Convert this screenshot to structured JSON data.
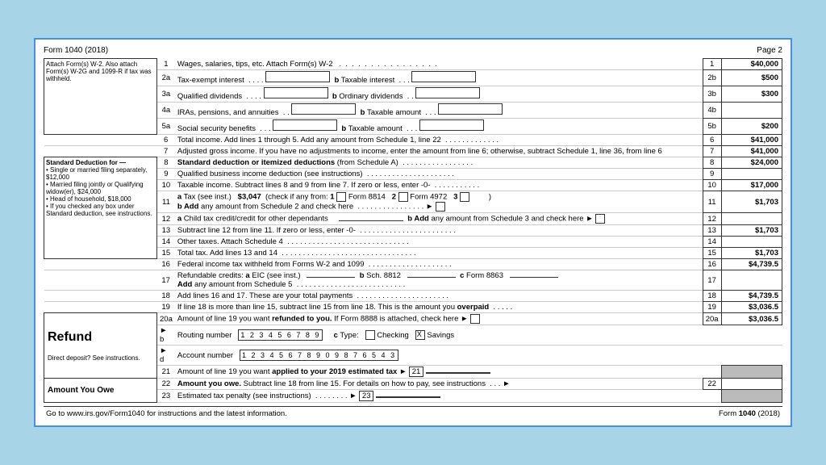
{
  "header": {
    "form_title": "Form 1040 (2018)",
    "page": "Page 2"
  },
  "sidebar_attach": "Attach Form(s) W-2. Also attach Form(s) W-2G and 1099-R if tax was withheld.",
  "sidebar_standard": {
    "title": "Standard Deduction for —",
    "items": [
      "• Single or married filing separately, $12,000",
      "• Married filing jointly or Qualifying widow(er), $24,000",
      "• Head of household, $18,000",
      "• If you checked any box under Standard deduction, see instructions."
    ]
  },
  "lines": {
    "l1": {
      "num": "1",
      "desc": "Wages, salaries, tips, etc. Attach Form(s) W-2",
      "amount": "$40,000"
    },
    "l2a": {
      "num": "2a",
      "desc": "Tax-exempt interest",
      "sub_num": "2a",
      "sub_label": "b Taxable interest",
      "sub_num2": "2b",
      "amount": "$500"
    },
    "l3a": {
      "num": "3a",
      "desc": "Qualified dividends",
      "sub_num": "3a",
      "sub_label": "b Ordinary dividends",
      "sub_num2": "3b",
      "amount": "$300"
    },
    "l4a": {
      "num": "4a",
      "desc": "IRAs, pensions, and annuities",
      "sub_num": "4a",
      "sub_label": "b Taxable amount",
      "sub_num2": "4b"
    },
    "l5a": {
      "num": "5a",
      "desc": "Social security benefits",
      "sub_num": "5a",
      "sub_label": "b Taxable amount",
      "sub_num2": "5b",
      "amount": "$200"
    },
    "l6": {
      "num": "6",
      "desc": "Total income. Add lines 1 through 5. Add any amount from Schedule 1, line 22",
      "amount": "$41,000"
    },
    "l7": {
      "num": "7",
      "desc": "Adjusted gross income. If you have no adjustments to income, enter the amount from line 6; otherwise, subtract Schedule 1, line 36, from line 6",
      "amount": "$41,000"
    },
    "l8": {
      "num": "8",
      "desc": "Standard deduction or itemized deductions (from Schedule A)",
      "amount": "$24,000"
    },
    "l9": {
      "num": "9",
      "desc": "Qualified business income deduction (see instructions)"
    },
    "l10": {
      "num": "10",
      "desc": "Taxable income. Subtract lines 8 and 9 from line 7. If zero or less, enter -0-",
      "amount": "$17,000"
    },
    "l11a_tax": "$3,047",
    "l11a_form8814": "8814",
    "l11a_form4972": "4972",
    "l11b_desc": "b Add any amount from Schedule 2 and check here",
    "l11_amount": "$1,703",
    "l12": {
      "num": "12",
      "desc": "a Child tax credit/credit for other dependents",
      "b_desc": "b Add any amount from Schedule 3 and check here ▶",
      "amount": ""
    },
    "l13": {
      "num": "13",
      "desc": "Subtract line 12 from line 11. If zero or less, enter -0-",
      "amount": "$1,703"
    },
    "l14": {
      "num": "14",
      "desc": "Other taxes. Attach Schedule 4"
    },
    "l15": {
      "num": "15",
      "desc": "Total tax. Add lines 13 and 14",
      "amount": "$1,703"
    },
    "l16": {
      "num": "16",
      "desc": "Federal income tax withheld from Forms W-2 and 1099",
      "amount": "$4,739.5"
    },
    "l17a_desc": "Refundable credits: a EIC (see inst.)",
    "l17b": "b Sch. 8812",
    "l17c": "c Form 8863",
    "l17_add": "Add any amount from Schedule 5",
    "l17_num": "17",
    "l18": {
      "num": "18",
      "desc": "Add lines 16 and 17. These are your total payments",
      "amount": "$4,739.5"
    },
    "l19": {
      "num": "19",
      "desc": "If line 18 is more than line 15, subtract line 15 from line 18. This is the amount you overpaid",
      "amount": "$3,036.5"
    },
    "l20a": {
      "num": "20a",
      "desc": "Amount of line 19 you want refunded to you. If Form 8888 is attached, check here ▶",
      "amount": "$3,036.5"
    },
    "l20b_routing": {
      "label": "▶ b Routing number",
      "value": "1 2 3 4 5 6 7 8 9"
    },
    "l20c_type": "c Type:",
    "l20c_checking": "Checking",
    "l20c_savings": "Savings",
    "l20d_account": {
      "label": "▶ d Account number",
      "value": "1 2 3 4 5 6 7 8 9 0 9 8 7 6 5 4 3"
    },
    "l21": {
      "num": "21",
      "desc": "Amount of line 19 you want applied to your 2019 estimated tax ▶"
    },
    "l22": {
      "num": "22",
      "desc": "Amount you owe. Subtract line 18 from line 15. For details on how to pay, see instructions ▶"
    },
    "l23": {
      "num": "23",
      "desc": "Estimated tax penalty (see instructions) . . . ▶"
    }
  },
  "footer": {
    "left": "Go to www.irs.gov/Form1040 for instructions and the latest information.",
    "right": "Form 1040 (2018)"
  }
}
